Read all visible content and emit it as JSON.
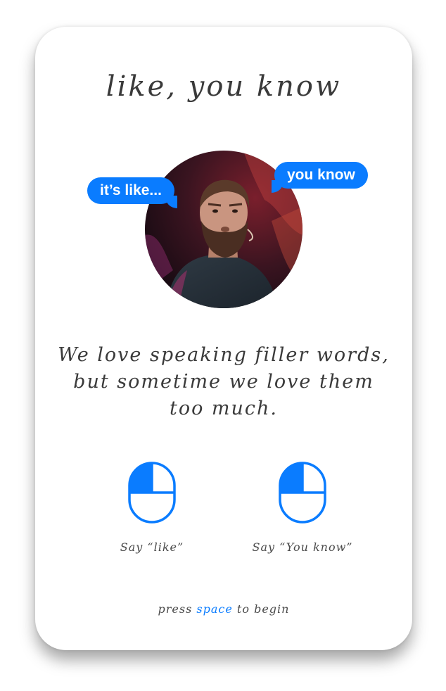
{
  "title": "like, you know",
  "bubbles": {
    "left": "it’s like...",
    "right": "you know"
  },
  "tagline": "We love speaking filler words, but sometime we love them too much.",
  "controls": [
    {
      "icon": "mouse-left-click-icon",
      "label": "Say “like”"
    },
    {
      "icon": "mouse-left-click-icon",
      "label": "Say “You know”"
    }
  ],
  "hint": {
    "before": "press",
    "key": "space",
    "after": "to begin"
  },
  "colors": {
    "accent": "#0a7cff",
    "text": "#3a3a3a",
    "background": "#ffffff"
  }
}
